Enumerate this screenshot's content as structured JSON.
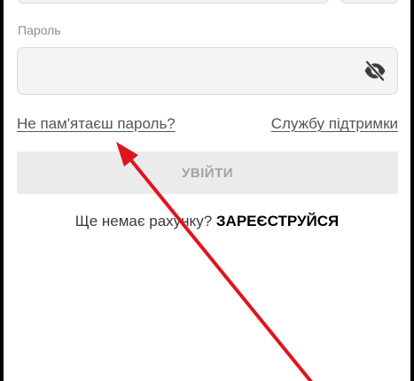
{
  "password": {
    "label": "Пароль",
    "value": "",
    "toggle_icon": "eye-off-icon"
  },
  "links": {
    "forgot_password": "Не пам'ятаєш пароль?",
    "support": "Службу підтримки"
  },
  "login_button": "УВІЙТИ",
  "signup": {
    "prompt": "Ще немає рахунку?",
    "link": "ЗАРЕЄСТРУЙСЯ"
  },
  "annotation": {
    "icon": "red-arrow-icon",
    "color": "#e0141e"
  },
  "colors": {
    "field_bg": "#f4f4f4",
    "button_bg": "#ebebeb",
    "button_text": "#a3a3a3"
  }
}
